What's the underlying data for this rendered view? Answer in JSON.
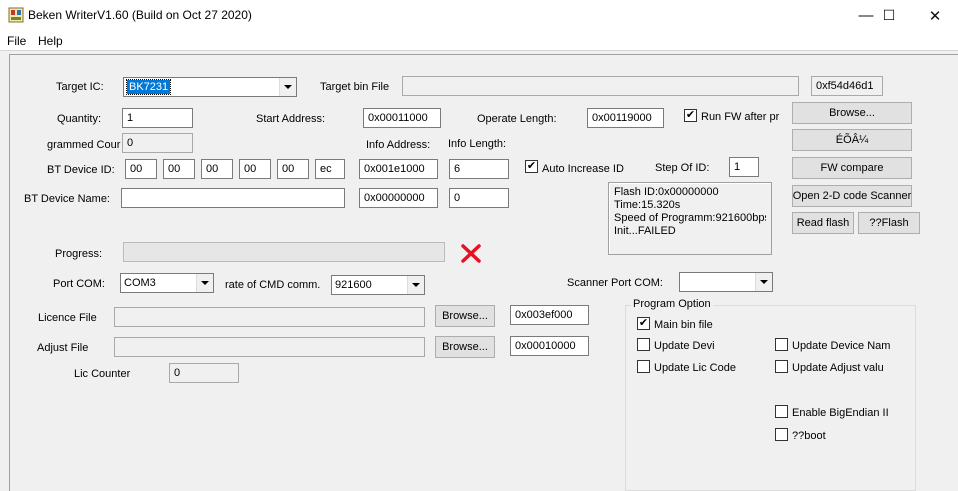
{
  "window": {
    "title": "Beken WriterV1.60 (Build on Oct 27 2020)",
    "minimize_glyph": "—",
    "maximize_glyph": "☐",
    "close_glyph": "✕"
  },
  "menu": {
    "file": "File",
    "help": "Help"
  },
  "target": {
    "ic_label": "Target IC:",
    "ic_value": "BK7231",
    "bin_label": "Target bin File",
    "bin_path": "",
    "checksum": "0xf54d46d1"
  },
  "quantity": {
    "label": "Quantity:",
    "value": "1"
  },
  "start_address": {
    "label": "Start Address:",
    "value": "0x00011000"
  },
  "operate_length": {
    "label": "Operate Length:",
    "value": "0x00119000"
  },
  "run_fw": {
    "label": "Run FW after pr",
    "checked": true
  },
  "programmed_count": {
    "label": "grammed Cour",
    "value": "0"
  },
  "info": {
    "address_label": "Info Address:",
    "length_label": "Info Length:",
    "address_value": "0x001e1000",
    "length_value": "6",
    "address2_value": "0x00000000",
    "length2_value": "0"
  },
  "bt_device_id": {
    "label": "BT Device ID:",
    "bytes": [
      "00",
      "00",
      "00",
      "00",
      "00",
      "ec"
    ]
  },
  "auto_increase": {
    "label": "Auto Increase ID",
    "checked": true
  },
  "step_of_id": {
    "label": "Step Of ID:",
    "value": "1"
  },
  "bt_device_name": {
    "label": "BT Device Name:",
    "value": ""
  },
  "status": {
    "lines": [
      "Flash ID:0x00000000",
      "Time:15.320s",
      "Speed of Programm:921600bps",
      "Init...FAILED"
    ]
  },
  "buttons": {
    "browse": "Browse...",
    "garbled": "ÉÕÂ¼",
    "fw_compare": "FW compare",
    "open_scanner": "Open 2-D code Scanner",
    "read_flash": "Read flash",
    "qflash": "??Flash",
    "licence_browse": "Browse...",
    "adjust_browse": "Browse..."
  },
  "progress": {
    "label": "Progress:",
    "value": 0,
    "result_icon": "fail-x-icon",
    "fail_color": "#e81123"
  },
  "port": {
    "label": "Port COM:",
    "value": "COM3",
    "rate_label": "rate of CMD comm.",
    "rate_value": "921600",
    "scanner_label": "Scanner Port COM:",
    "scanner_value": ""
  },
  "licence": {
    "label": "Licence File",
    "path": "",
    "address": "0x003ef000"
  },
  "adjust": {
    "label": "Adjust File",
    "path": "",
    "address": "0x00010000"
  },
  "lic_counter": {
    "label": "Lic Counter",
    "value": "0"
  },
  "program_option": {
    "title": "Program Option",
    "main_bin": {
      "label": "Main bin file",
      "checked": true
    },
    "update_devi": {
      "label": "Update Devi",
      "checked": false
    },
    "update_device_name": {
      "label": "Update Device Nam",
      "checked": false
    },
    "update_lic_code": {
      "label": "Update Lic Code",
      "checked": false
    },
    "update_adjust": {
      "label": "Update Adjust valu",
      "checked": false
    },
    "big_endian": {
      "label": "Enable BigEndian II",
      "checked": false
    },
    "qboot": {
      "label": "??boot",
      "checked": false
    }
  },
  "accent_color": "#0078d7"
}
